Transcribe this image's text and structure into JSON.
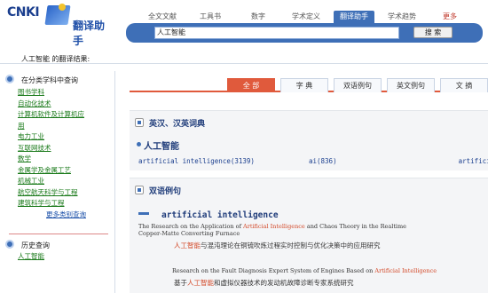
{
  "header": {
    "logo_text": "CNKI",
    "logo_subtitle": "翻译助手",
    "nav_tabs": [
      "全文文献",
      "工具书",
      "数字",
      "学术定义",
      "翻译助手",
      "学术趋势",
      "更多"
    ],
    "active_tab": "翻译助手",
    "search_value": "人工智能",
    "search_button": "搜 索"
  },
  "result_bar": {
    "text": "人工智能 的翻译结果:"
  },
  "sidebar": {
    "section1_title": "在分类学科中查询",
    "categories": [
      "图书学科",
      "自动化技术",
      "计算机软件及计算机应",
      "用",
      "电力工业",
      "互联网技术",
      "数学",
      "金属学及金属工艺",
      "机械工业",
      "航空航天科学与工程",
      "建筑科学与工程"
    ],
    "more_link": "更多类别查询",
    "section2_title": "历史查询",
    "history": [
      "人工智能"
    ]
  },
  "tabs": [
    "全 部",
    "字 典",
    "双语例句",
    "英文例句",
    "文 摘"
  ],
  "dictionary": {
    "title": "英汉、汉英词典",
    "term": "人工智能",
    "translations": [
      {
        "text": "artificial intelligence",
        "count": "(3139)"
      },
      {
        "text": "ai",
        "count": "(836)"
      },
      {
        "text": "artificial",
        "count": ""
      }
    ]
  },
  "bilingual": {
    "title": "双语例句",
    "phrase": "artificial intelligence",
    "examples": [
      {
        "en_before": "The Research on the Application of ",
        "en_hl": "Artificial Intelligence",
        "en_after": " and Chaos Theory in the Realtime",
        "en_line2": "Copper-Matte Converting Furnace",
        "zh_hl": "人工智能",
        "zh_after": "与混沌理论在铜锍吹炼过程实时控制与优化决策中的应用研究"
      },
      {
        "en_before": "Research on the Fault Diagnosis Expert System of Engines Based on ",
        "en_hl": "Artificial Intelligence",
        "en_after": "",
        "en_line2": "",
        "zh_before": "基于",
        "zh_hl": "人工智能",
        "zh_after": "和虚拟仪器技术的发动机故障诊断专家系统研究"
      }
    ]
  }
}
